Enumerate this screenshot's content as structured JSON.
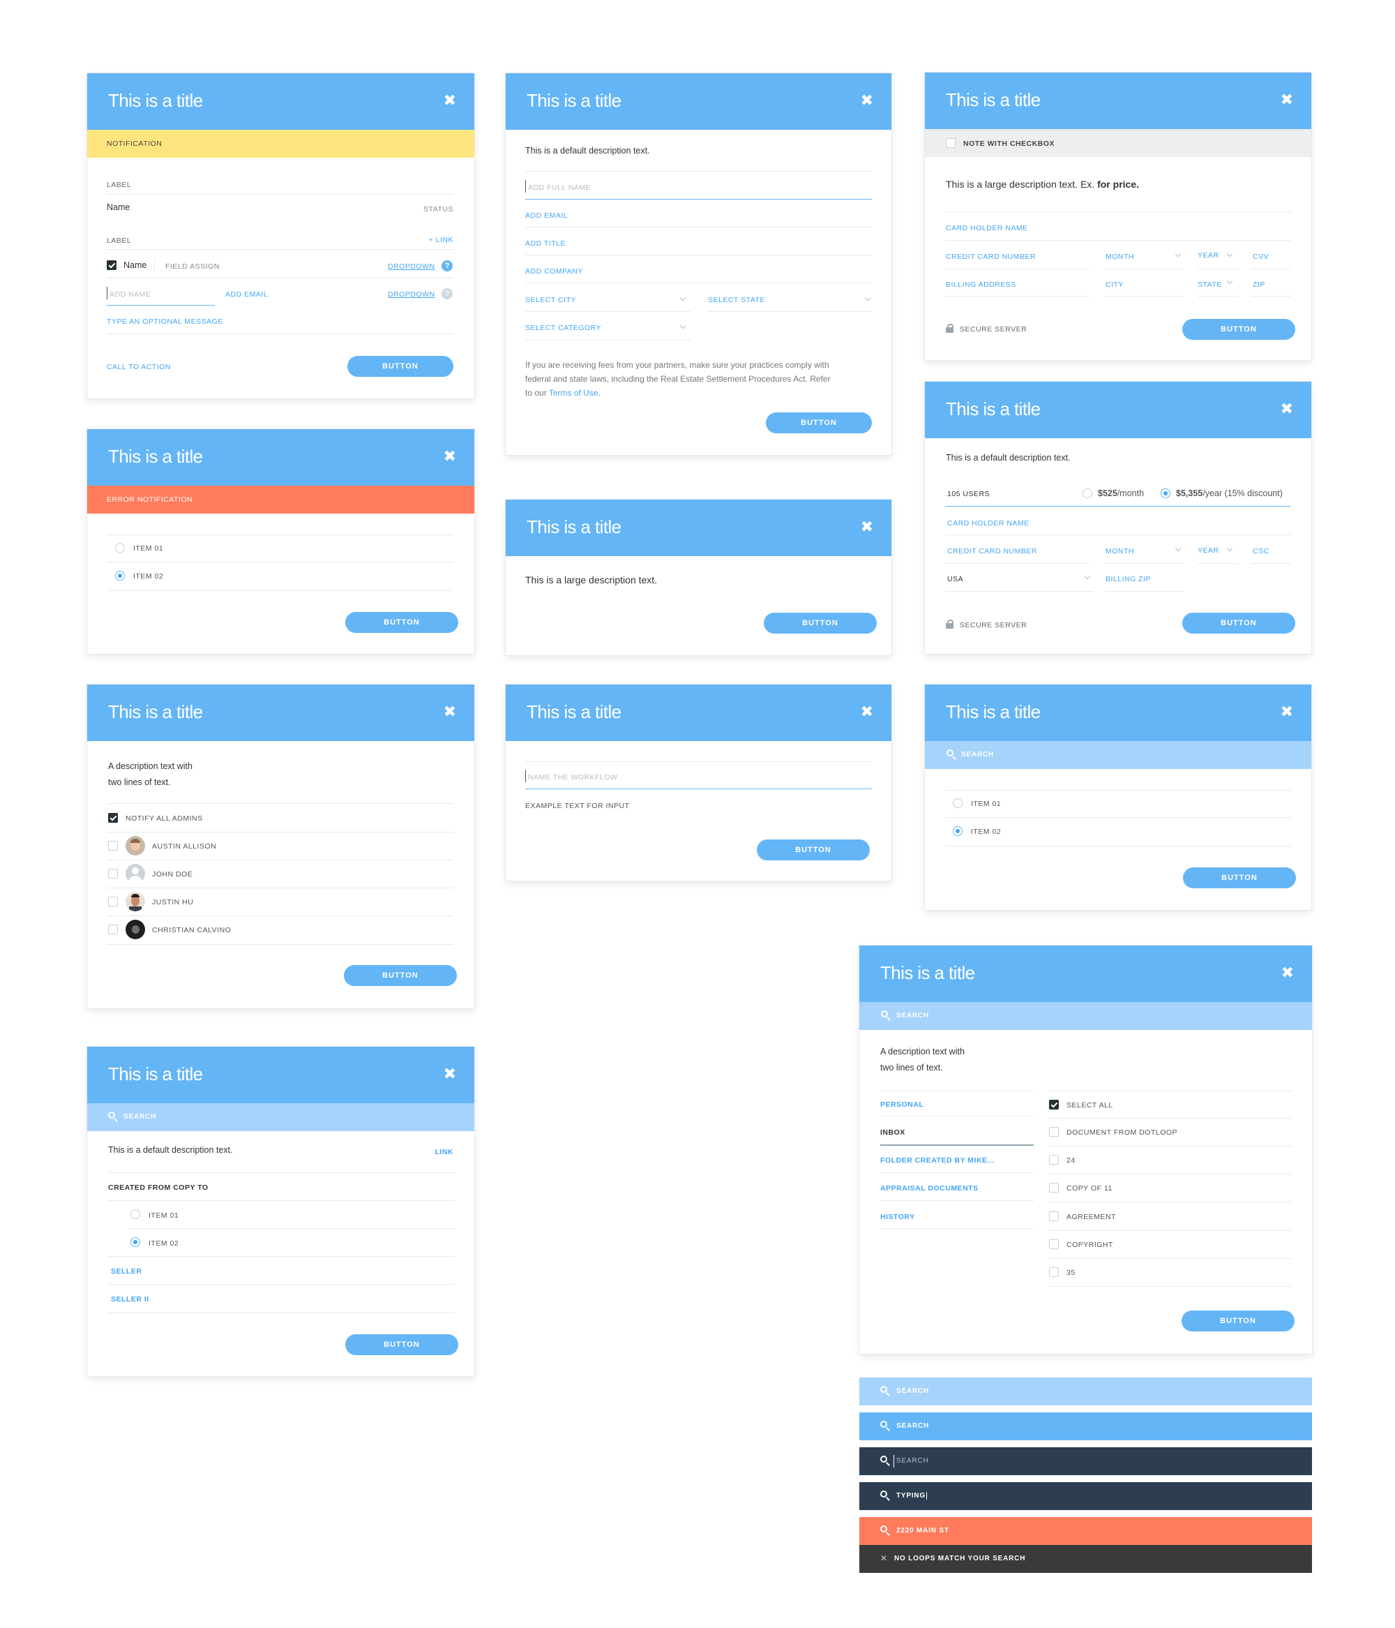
{
  "common": {
    "title": "This is a title",
    "close": "✖",
    "button": "BUTTON",
    "search": "SEARCH",
    "item01": "ITEM 01",
    "item02": "ITEM 02"
  },
  "m1": {
    "notification": "NOTIFICATION",
    "label1": "LABEL",
    "name": "Name",
    "status": "STATUS",
    "label2": "LABEL",
    "link": "+ LINK",
    "check_name": "Name",
    "field_assign": "FIELD ASSIGN",
    "dropdown1": "DROPDOWN",
    "add_name": "ADD NAME",
    "add_email": "ADD EMAIL",
    "dropdown2": "DROPDOWN",
    "optional": "TYPE AN OPTIONAL MESSAGE",
    "cta": "CALL TO ACTION",
    "help": "?"
  },
  "m2": {
    "desc": "This is a default description text.",
    "full_name": "ADD FULL NAME",
    "email": "ADD EMAIL",
    "title_f": "ADD TITLE",
    "company": "ADD COMPANY",
    "city": "SELECT CITY",
    "state": "SELECT STATE",
    "category": "SELECT CATEGORY",
    "legal1": "If you are receiving fees from your partners, make sure your practices comply with",
    "legal2": "federal and state laws, including the Real Estate Settlement Procedures Act. Refer",
    "legal3_pre": "to our ",
    "legal3_link": "Terms of Use",
    "legal3_post": "."
  },
  "m3": {
    "note": "NOTE WITH CHECKBOX",
    "desc_pre": "This is a large description text. Ex. ",
    "desc_bold": "for price.",
    "holder": "CARD HOLDER NAME",
    "ccn": "CREDIT CARD NUMBER",
    "month": "MONTH",
    "year": "YEAR",
    "cvv": "CVV",
    "billing": "BILLING ADDRESS",
    "city": "CITY",
    "state": "STATE",
    "zip": "ZIP",
    "secure": "SECURE SERVER"
  },
  "m4": {
    "error": "ERROR NOTIFICATION"
  },
  "m5": {
    "desc": "This is a large description text."
  },
  "m6": {
    "desc": "This is a default description text.",
    "users": "105 USERS",
    "price1_b": "$525",
    "price1_r": "/month",
    "price2_b": "$5,355",
    "price2_r": "/year (15% discount)",
    "holder": "CARD HOLDER NAME",
    "ccn": "CREDIT CARD NUMBER",
    "month": "MONTH",
    "year": "YEAR",
    "csc": "CSC",
    "country": "USA",
    "bzip": "BILLING ZIP",
    "secure": "SECURE SERVER"
  },
  "m7": {
    "desc1": "A description text with",
    "desc2": "two lines of text.",
    "notify": "NOTIFY ALL ADMINS",
    "people": [
      "AUSTIN ALLISON",
      "JOHN DOE",
      "JUSTIN HU",
      "CHRISTIAN CALVINO"
    ]
  },
  "m8": {
    "placeholder": "NAME THE WORKFLOW",
    "example": "EXAMPLE TEXT FOR INPUT"
  },
  "m10": {
    "desc": "This is a default description text.",
    "link": "LINK",
    "created": "CREATED FROM COPY TO",
    "seller": "SELLER",
    "seller2": "SELLER II"
  },
  "m11": {
    "desc1": "A description text with",
    "desc2": "two lines of text.",
    "folders": [
      "PERSONAL",
      "INBOX",
      "FOLDER CREATED BY MIKE...",
      "APPRAISAL DOCUMENTS",
      "HISTORY"
    ],
    "select_all": "SELECT ALL",
    "docs": [
      "DOCUMENT FROM DOTLOOP",
      "24",
      "COPY OF 11",
      "AGREEMENT",
      "COPYRIGHT",
      "35"
    ]
  },
  "bars": {
    "b1": "SEARCH",
    "b2": "SEARCH",
    "b3": "SEARCH",
    "b4": "TYPING",
    "b5": "2220 MAIN ST",
    "b6": "NO LOOPS MATCH YOUR SEARCH",
    "x": "✕"
  },
  "colors": {
    "header": "#64b5f6",
    "accent": "#42a5f5",
    "notification": "#ffe57f",
    "error": "#ff7b5c",
    "search_light": "#a6d3fb",
    "dark": "#2c3e50",
    "charcoal": "#3a3a3a"
  }
}
